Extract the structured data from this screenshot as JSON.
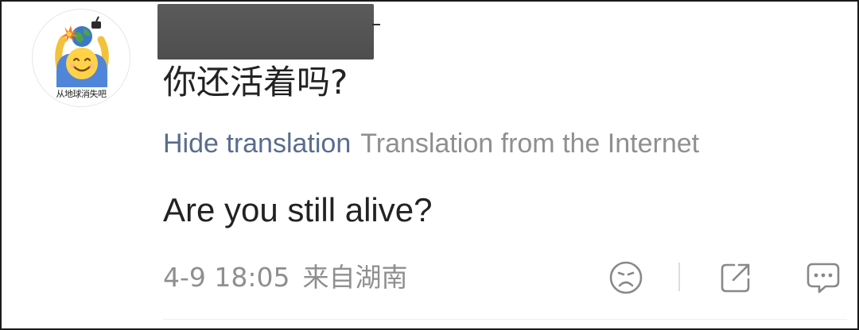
{
  "avatar": {
    "caption": "从地球消失吧"
  },
  "post": {
    "text": "你还活着吗?"
  },
  "translation": {
    "toggle_label": "Hide translation",
    "source_label": "Translation from the Internet",
    "translated_text": "Are you still alive?"
  },
  "meta": {
    "timestamp": "4-9 18:05",
    "location": "来自湖南"
  },
  "actions": {
    "dislike_icon": "sad-face-icon",
    "share_icon": "share-icon",
    "comment_icon": "comment-icon"
  },
  "colors": {
    "link": "#5a6c8e",
    "muted": "#8f8f8f",
    "text": "#222222",
    "redaction": "#555555"
  }
}
